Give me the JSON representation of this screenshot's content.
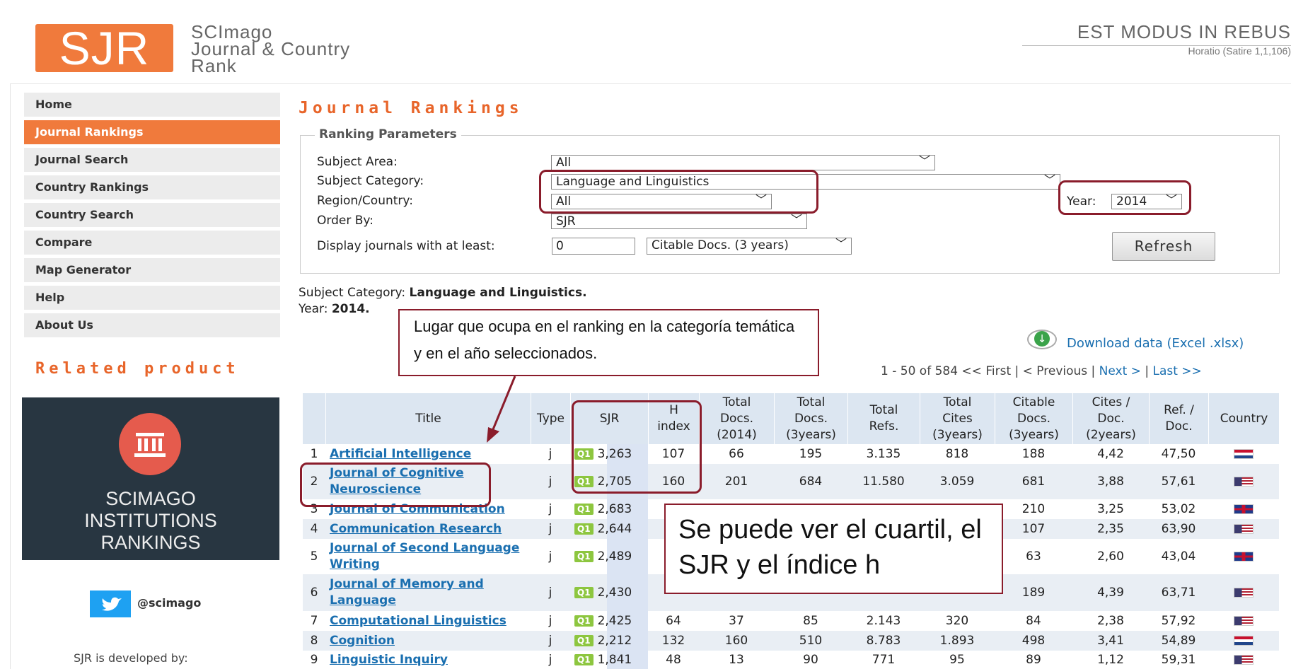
{
  "header": {
    "logo": "SJR",
    "site_name_lines": [
      "SCImago",
      "Journal & Country",
      "Rank"
    ],
    "motto": "EST MODUS IN REBUS",
    "motto_source": "Horatio (Satire 1,1,106)"
  },
  "sidebar": {
    "items": [
      {
        "label": "Home",
        "active": false
      },
      {
        "label": "Journal Rankings",
        "active": true
      },
      {
        "label": "Journal Search",
        "active": false
      },
      {
        "label": "Country Rankings",
        "active": false
      },
      {
        "label": "Country Search",
        "active": false
      },
      {
        "label": "Compare",
        "active": false
      },
      {
        "label": "Map Generator",
        "active": false
      },
      {
        "label": "Help",
        "active": false
      },
      {
        "label": "About Us",
        "active": false
      }
    ],
    "related_title": "Related product",
    "promo_lines": [
      "SCIMAGO",
      "INSTITUTIONS",
      "RANKINGS"
    ],
    "twitter_handle": "@scimago",
    "developed_by": "SJR is developed by:"
  },
  "main": {
    "title": "Journal Rankings",
    "params": {
      "legend": "Ranking Parameters",
      "subject_area_label": "Subject Area:",
      "subject_area_value": "All",
      "subject_category_label": "Subject Category:",
      "subject_category_value": "Language and Linguistics",
      "region_label": "Region/Country:",
      "region_value": "All",
      "year_label": "Year:",
      "year_value": "2014",
      "order_label": "Order By:",
      "order_value": "SJR",
      "display_label": "Display journals with at least:",
      "min_value": "0",
      "min_type": "Citable Docs. (3 years)",
      "refresh_label": "Refresh"
    },
    "summary": {
      "category_label": "Subject Category: ",
      "category_value": "Language and Linguistics.",
      "year_label": "Year: ",
      "year_value": "2014."
    },
    "download_label": "Download data (Excel .xlsx)",
    "pager": {
      "range": "1 - 50 of 584 << First | < Previous | ",
      "next": "Next >",
      "sep": " | ",
      "last": "Last >>"
    },
    "table": {
      "headers": [
        "Title",
        "Type",
        "SJR",
        "H\nindex",
        "Total\nDocs.\n(2014)",
        "Total\nDocs.\n(3years)",
        "Total\nRefs.",
        "Total\nCites\n(3years)",
        "Citable\nDocs.\n(3years)",
        "Cites /\nDoc.\n(2years)",
        "Ref. /\nDoc.",
        "Country"
      ],
      "rows": [
        {
          "rank": "1",
          "title": "Artificial Intelligence",
          "type": "j",
          "quartile": "Q1",
          "sjr": "3,263",
          "h": "107",
          "docs2014": "66",
          "docs3y": "195",
          "refs": "3.135",
          "cites3y": "818",
          "citable3y": "188",
          "cites_doc": "4,42",
          "ref_doc": "47,50",
          "country": "netherlands-flag"
        },
        {
          "rank": "2",
          "title": "Journal of Cognitive Neuroscience",
          "type": "j",
          "quartile": "Q1",
          "sjr": "2,705",
          "h": "160",
          "docs2014": "201",
          "docs3y": "684",
          "refs": "11.580",
          "cites3y": "3.059",
          "citable3y": "681",
          "cites_doc": "3,88",
          "ref_doc": "57,61",
          "country": "usa-flag"
        },
        {
          "rank": "3",
          "title": "Journal of Communication",
          "type": "j",
          "quartile": "Q1",
          "sjr": "2,683",
          "h": "",
          "docs2014": "",
          "docs3y": "",
          "refs": "",
          "cites3y": "",
          "citable3y": "210",
          "cites_doc": "3,25",
          "ref_doc": "53,02",
          "country": "uk-flag"
        },
        {
          "rank": "4",
          "title": "Communication Research",
          "type": "j",
          "quartile": "Q1",
          "sjr": "2,644",
          "h": "",
          "docs2014": "",
          "docs3y": "",
          "refs": "",
          "cites3y": "",
          "citable3y": "107",
          "cites_doc": "2,35",
          "ref_doc": "63,90",
          "country": "usa-flag"
        },
        {
          "rank": "5",
          "title": "Journal of Second Language Writing",
          "type": "j",
          "quartile": "Q1",
          "sjr": "2,489",
          "h": "",
          "docs2014": "",
          "docs3y": "",
          "refs": "",
          "cites3y": "",
          "citable3y": "63",
          "cites_doc": "2,60",
          "ref_doc": "43,04",
          "country": "uk-flag"
        },
        {
          "rank": "6",
          "title": "Journal of Memory and Language",
          "type": "j",
          "quartile": "Q1",
          "sjr": "2,430",
          "h": "",
          "docs2014": "",
          "docs3y": "",
          "refs": "",
          "cites3y": "",
          "citable3y": "189",
          "cites_doc": "4,39",
          "ref_doc": "63,71",
          "country": "usa-flag"
        },
        {
          "rank": "7",
          "title": "Computational Linguistics",
          "type": "j",
          "quartile": "Q1",
          "sjr": "2,425",
          "h": "64",
          "docs2014": "37",
          "docs3y": "85",
          "refs": "2.143",
          "cites3y": "320",
          "citable3y": "84",
          "cites_doc": "2,38",
          "ref_doc": "57,92",
          "country": "usa-flag"
        },
        {
          "rank": "8",
          "title": "Cognition",
          "type": "j",
          "quartile": "Q1",
          "sjr": "2,212",
          "h": "132",
          "docs2014": "160",
          "docs3y": "510",
          "refs": "8.783",
          "cites3y": "1.893",
          "citable3y": "498",
          "cites_doc": "3,41",
          "ref_doc": "54,89",
          "country": "netherlands-flag"
        },
        {
          "rank": "9",
          "title": "Linguistic Inquiry",
          "type": "j",
          "quartile": "Q1",
          "sjr": "1,841",
          "h": "48",
          "docs2014": "13",
          "docs3y": "90",
          "refs": "771",
          "cites3y": "95",
          "citable3y": "89",
          "cites_doc": "1,12",
          "ref_doc": "59,31",
          "country": "usa-flag"
        }
      ]
    }
  },
  "annotations": {
    "callout1": "Lugar que ocupa en el ranking en la categoría temática y en el año seleccionados.",
    "callout2": "Se puede ver el cuartil, el SJR y el índice h",
    "highlight_color": "#8a1c2b"
  }
}
